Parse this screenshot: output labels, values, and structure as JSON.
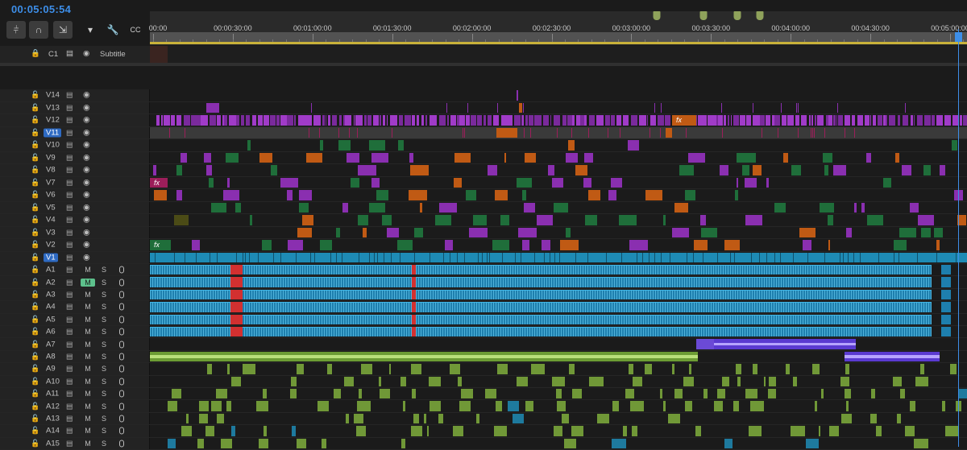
{
  "timecode": "00:05:05:54",
  "toolbar": [
    {
      "name": "insert-edit-icon",
      "glyph": "⫩",
      "on": true
    },
    {
      "name": "snap-icon",
      "glyph": "∩",
      "on": true
    },
    {
      "name": "linked-selection-icon",
      "glyph": "⇲",
      "on": true
    },
    {
      "name": "add-marker-icon",
      "glyph": "▾",
      "on": false
    },
    {
      "name": "settings-wrench-icon",
      "glyph": "🔧",
      "on": false
    },
    {
      "name": "captions-icon",
      "glyph": "CC",
      "on": false
    }
  ],
  "ruler": {
    "labels": [
      "00:00",
      "00:00:30:00",
      "00:01:00:00",
      "00:01:30:00",
      "00:02:00:00",
      "00:02:30:00",
      "00:03:00:00",
      "00:03:30:00",
      "00:04:00:00",
      "00:04:30:00",
      "00:05:00:00"
    ]
  },
  "subtitle_track": {
    "name": "C1",
    "label": "Subtitle"
  },
  "video_tracks": [
    {
      "name": "V14",
      "selected": false
    },
    {
      "name": "V13",
      "selected": false
    },
    {
      "name": "V12",
      "selected": false
    },
    {
      "name": "V11",
      "selected": true
    },
    {
      "name": "V10",
      "selected": false
    },
    {
      "name": "V9",
      "selected": false
    },
    {
      "name": "V8",
      "selected": false
    },
    {
      "name": "V7",
      "selected": false
    },
    {
      "name": "V6",
      "selected": false
    },
    {
      "name": "V5",
      "selected": false
    },
    {
      "name": "V4",
      "selected": false
    },
    {
      "name": "V3",
      "selected": false
    },
    {
      "name": "V2",
      "selected": false
    },
    {
      "name": "V1",
      "selected": true
    }
  ],
  "audio_tracks": [
    {
      "name": "A1",
      "m": "M",
      "s": "S",
      "m_on": false
    },
    {
      "name": "A2",
      "m": "M",
      "s": "S",
      "m_on": true
    },
    {
      "name": "A3",
      "m": "M",
      "s": "S",
      "m_on": false
    },
    {
      "name": "A4",
      "m": "M",
      "s": "S",
      "m_on": false
    },
    {
      "name": "A5",
      "m": "M",
      "s": "S",
      "m_on": false
    },
    {
      "name": "A6",
      "m": "M",
      "s": "S",
      "m_on": false
    },
    {
      "name": "A7",
      "m": "M",
      "s": "S",
      "m_on": false
    },
    {
      "name": "A8",
      "m": "M",
      "s": "S",
      "m_on": false
    },
    {
      "name": "A9",
      "m": "M",
      "s": "S",
      "m_on": false
    },
    {
      "name": "A10",
      "m": "M",
      "s": "S",
      "m_on": false
    },
    {
      "name": "A11",
      "m": "M",
      "s": "S",
      "m_on": false
    },
    {
      "name": "A12",
      "m": "M",
      "s": "S",
      "m_on": false
    },
    {
      "name": "A13",
      "m": "M",
      "s": "S",
      "m_on": false
    },
    {
      "name": "A14",
      "m": "M",
      "s": "S",
      "m_on": false
    },
    {
      "name": "A15",
      "m": "M",
      "s": "S",
      "m_on": false
    }
  ],
  "fx_label": "fx",
  "colors": {
    "accent_blue": "#3d8ee8",
    "clip_purple": "#8a2fb0",
    "clip_green": "#1f6e3a",
    "clip_orange": "#c05a14",
    "clip_cyan": "#1e8bb5",
    "clip_lime": "#7fae3c",
    "clip_violet": "#6b4ad6",
    "clip_magenta": "#9c1e5a"
  }
}
